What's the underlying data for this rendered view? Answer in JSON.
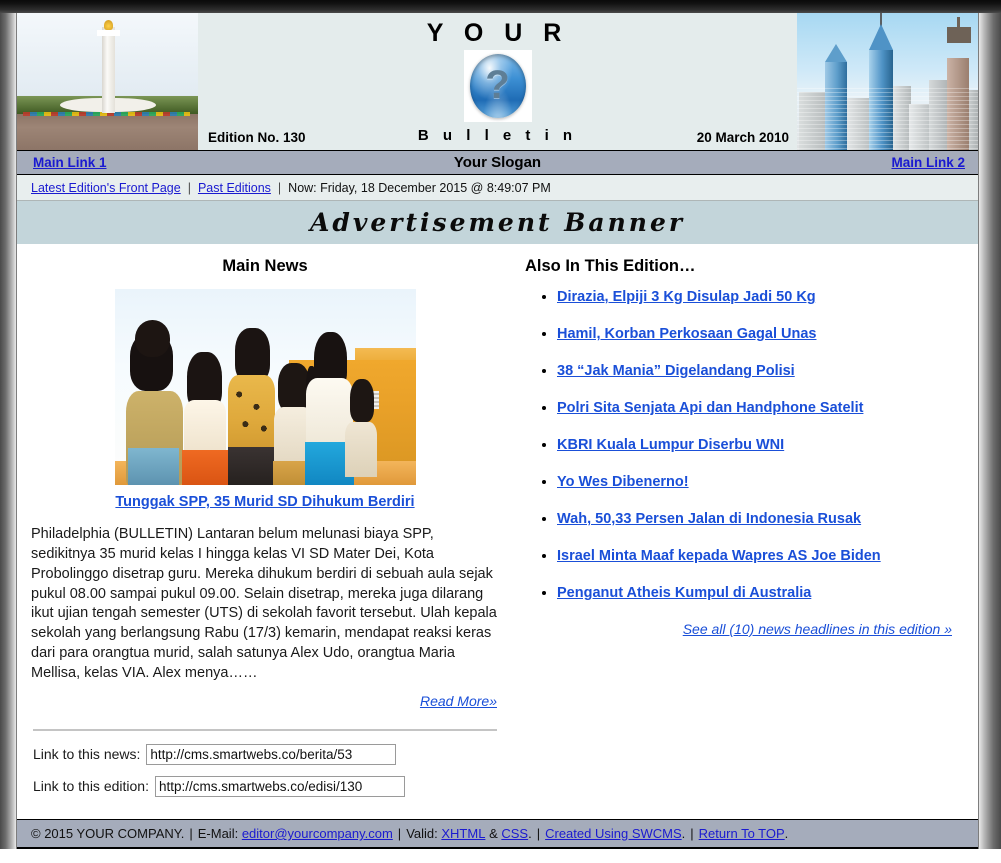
{
  "masthead": {
    "title": "Y O U R",
    "subtitle": "B u l l e t i n",
    "logo_glyph": "?",
    "edition_label": "Edition No. 130",
    "date": "20 March 2010",
    "left_image_alt": "monas-monument-photo",
    "right_image_alt": "philadelphia-skyline-photo"
  },
  "mainnav": {
    "link_left": "Main Link 1",
    "slogan": "Your Slogan",
    "link_right": "Main Link 2"
  },
  "subnav": {
    "front_page": "Latest Edition's Front Page",
    "past_editions": "Past Editions",
    "now": "Now: Friday, 18 December 2015 @ 8:49:07 PM"
  },
  "ad": {
    "text": "Advertisement Banner"
  },
  "main_news": {
    "section_title": "Main News",
    "photo_alt": "schoolgirls-standing-punishment-photo",
    "headline": "Tunggak SPP, 35 Murid SD Dihukum Berdiri",
    "body": "Philadelphia (BULLETIN) Lantaran belum melunasi biaya SPP, sedikitnya 35 murid kelas I hingga kelas VI SD Mater Dei, Kota Probolinggo disetrap guru. Mereka dihukum berdiri di sebuah aula sejak pukul 08.00 sampai pukul 09.00. Selain disetrap, mereka juga dilarang ikut ujian tengah semester (UTS) di sekolah favorit tersebut. Ulah kepala sekolah yang berlangsung Rabu (17/3) kemarin, mendapat reaksi keras dari para orangtua murid, salah satunya Alex Udo, orangtua Maria Mellisa, kelas VIA. Alex menya……",
    "read_more": "Read More»"
  },
  "links": {
    "news_label": "Link to this news:",
    "news_value": "http://cms.smartwebs.co/berita/53",
    "edition_label": "Link to this edition:",
    "edition_value": "http://cms.smartwebs.co/edisi/130"
  },
  "also": {
    "title": "Also In This Edition…",
    "headlines": [
      "Dirazia, Elpiji 3 Kg Disulap Jadi 50 Kg",
      "Hamil, Korban Perkosaan Gagal Unas",
      "38 “Jak Mania” Digelandang Polisi",
      "Polri Sita Senjata Api dan Handphone Satelit",
      "KBRI Kuala Lumpur Diserbu WNI",
      "Yo Wes Dibenerno!",
      "Wah, 50,33 Persen Jalan di Indonesia Rusak",
      "Israel Minta Maaf kepada Wapres AS Joe Biden",
      "Penganut Atheis Kumpul di Australia"
    ],
    "see_all": "See all (10) news headlines in this edition »"
  },
  "footer": {
    "copyright": "© 2015 YOUR COMPANY.",
    "email_label": "E-Mail:",
    "email": "editor@yourcompany.com",
    "valid_label": "Valid:",
    "xhtml": "XHTML",
    "amp": "&",
    "css": "CSS",
    "css_dot": ".",
    "created": "Created Using SWCMS",
    "created_dot": ".",
    "return_top": "Return To TOP",
    "return_dot": ".",
    "pipe": "|"
  },
  "colors": {
    "nav_bar": "#a5acbb",
    "ad_banner": "#c3d5da",
    "subnav": "#e8eeee",
    "masthead": "#e4ecec",
    "link": "#1a4fd8",
    "nav_link": "#1a1ad0"
  }
}
